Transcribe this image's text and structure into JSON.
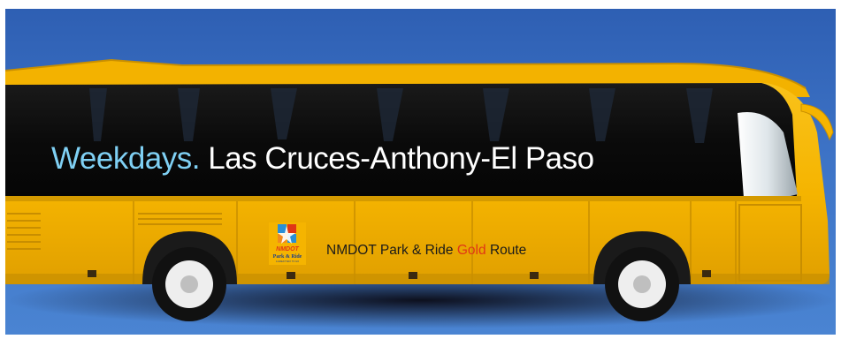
{
  "headline": {
    "lead": "Weekdays.",
    "rest": "Las Cruces-Anthony-El Paso"
  },
  "route_label": {
    "prefix": "NMDOT Park & Ride",
    "highlight": "Gold",
    "suffix": "Route"
  },
  "logo": {
    "name": "nmdot-park-and-ride-logo",
    "lettering": [
      "NMDOT",
      "Park & Ride",
      "A GREAT WAY TO GO"
    ]
  },
  "colors": {
    "sky": "#3d73c6",
    "bus_body": "#f7b500",
    "window_band": "#0d0d0d",
    "headline_lead": "#7fd0f4",
    "headline_rest": "#ffffff",
    "route_highlight": "#e03616"
  }
}
